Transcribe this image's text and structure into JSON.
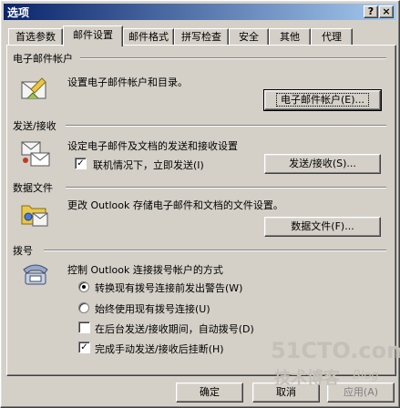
{
  "window": {
    "title": "选项",
    "help_label": "?",
    "close_label": "×"
  },
  "tabs": [
    {
      "label": "首选参数"
    },
    {
      "label": "邮件设置"
    },
    {
      "label": "邮件格式"
    },
    {
      "label": "拼写检查"
    },
    {
      "label": "安全"
    },
    {
      "label": "其他"
    },
    {
      "label": "代理"
    }
  ],
  "active_tab": "邮件设置",
  "sections": {
    "accounts": {
      "title": "电子邮件帐户",
      "description": "设置电子邮件帐户和目录。",
      "button": "电子邮件帐户(E)..."
    },
    "send_receive": {
      "title": "发送/接收",
      "description": "设定电子邮件及文档的发送和接收设置",
      "checkbox_label": "联机情况下，立即发送(I)",
      "checkbox_checked": true,
      "button": "发送/接收(S)..."
    },
    "data_files": {
      "title": "数据文件",
      "description": "更改 Outlook 存储电子邮件和文档的文件设置。",
      "button": "数据文件(F)..."
    },
    "dialup": {
      "title": "拨号",
      "description": "控制 Outlook 连接拨号帐户的方式",
      "options": [
        {
          "label": "转换现有拨号连接前发出警告(W)",
          "type": "radio",
          "checked": true
        },
        {
          "label": "始终使用现有拨号连接(U)",
          "type": "radio",
          "checked": false
        },
        {
          "label": "在后台发送/接收期间，自动拨号(D)",
          "type": "checkbox",
          "checked": false
        },
        {
          "label": "完成手动发送/接收后挂断(H)",
          "type": "checkbox",
          "checked": true
        }
      ]
    }
  },
  "footer": {
    "ok_label": "确定",
    "cancel_label": "取消",
    "apply_label": "应用(A)"
  },
  "watermark": {
    "site": "51CTO.com",
    "tagline": "技术博客",
    "blog": "Blog"
  },
  "colors": {
    "face": "#d4d0c8",
    "title_start": "#0a246a",
    "title_end": "#a6caf0",
    "watermark": "#c4c0b8"
  }
}
